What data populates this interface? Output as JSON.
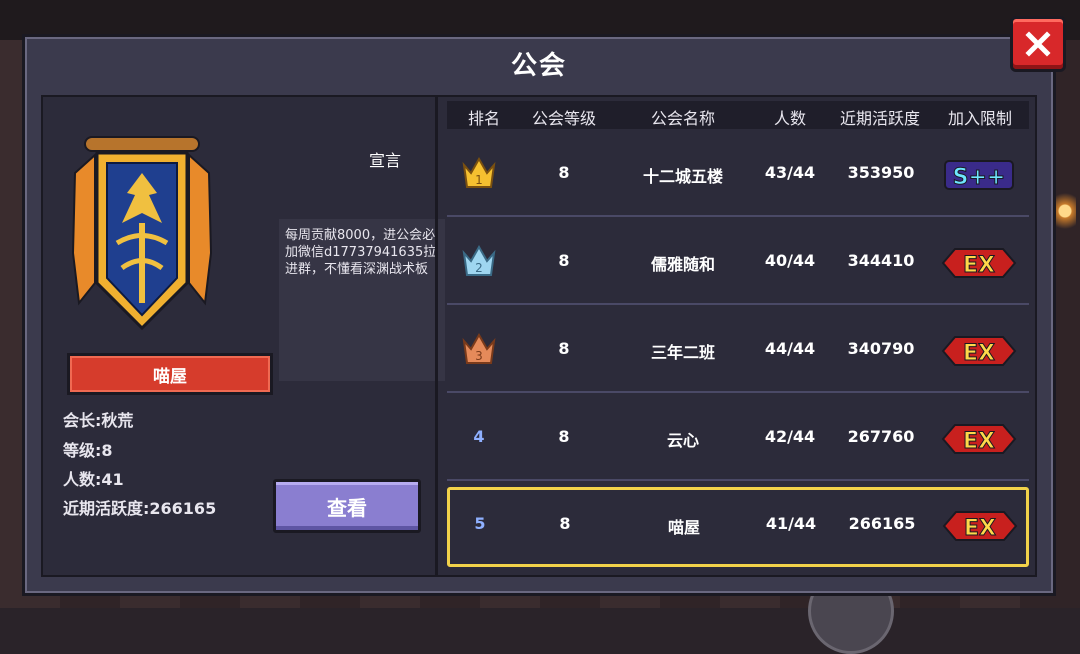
{
  "title": "公会",
  "guild": {
    "name": "喵屋",
    "manifesto_label": "宣言",
    "manifesto": "每周贡献8000，进公会必加微信d17737941635拉进群，不懂看深渊战术板",
    "leader": "会长:秋荒",
    "level": "等级:8",
    "members": "人数:41",
    "activity": "近期活跃度:266165",
    "view_button": "查看"
  },
  "table": {
    "headers": [
      "排名",
      "公会等级",
      "公会名称",
      "人数",
      "近期活跃度",
      "加入限制"
    ],
    "rows": [
      {
        "rank": "1",
        "level": "8",
        "name": "十二城五楼",
        "members": "43/44",
        "activity": "353950",
        "limit": "S++"
      },
      {
        "rank": "2",
        "level": "8",
        "name": "儒雅随和",
        "members": "40/44",
        "activity": "344410",
        "limit": "EX"
      },
      {
        "rank": "3",
        "level": "8",
        "name": "三年二班",
        "members": "44/44",
        "activity": "340790",
        "limit": "EX"
      },
      {
        "rank": "4",
        "level": "8",
        "name": "云心",
        "members": "42/44",
        "activity": "267760",
        "limit": "EX"
      },
      {
        "rank": "5",
        "level": "8",
        "name": "喵屋",
        "members": "41/44",
        "activity": "266165",
        "limit": "EX"
      }
    ]
  },
  "colors": {
    "gold": "#f5c030",
    "silver": "#9fd6f0",
    "bronze": "#e58a5a",
    "highlight": "#f2d24a"
  }
}
